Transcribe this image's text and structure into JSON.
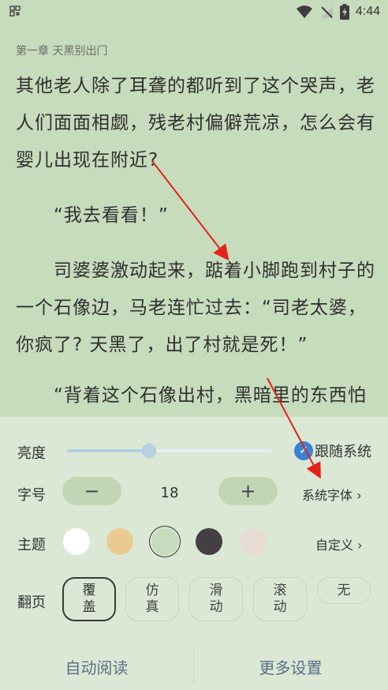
{
  "status_bar": {
    "left_icon": "qr-grid-icon",
    "icons": [
      "wifi-icon",
      "no-signal-icon",
      "battery-charging-icon"
    ],
    "time": "4:44"
  },
  "reader": {
    "chapter_title": "第一章 天黑别出门",
    "paragraphs": [
      "其他老人除了耳聋的都听到了这个哭声，老人们面面相觑，残老村偏僻荒凉，怎么会有婴儿出现在附近?",
      "“我去看看！”",
      "司婆婆激动起来，踮着小脚跑到村子的一个石像边，马老连忙过去：“司老太婆，你疯了? 天黑了，出了村就是死！”",
      "“背着这个石像出村，黑暗里的东西怕"
    ]
  },
  "settings": {
    "brightness": {
      "label": "亮度",
      "level": 0.4,
      "follow_system_label": "跟随系统",
      "follow_system_checked": true
    },
    "font": {
      "label": "字号",
      "decrease_label": "−",
      "value": "18",
      "increase_label": "+",
      "font_link": "系统字体 ›"
    },
    "theme": {
      "label": "主题",
      "colors": [
        "#ffffff",
        "#ebca92",
        "#c7dbbd",
        "#433f42",
        "#e6dcd4"
      ],
      "selected_index": 2,
      "custom_link": "自定义 ›"
    },
    "page_turn": {
      "label": "翻页",
      "options": [
        "覆盖",
        "仿真",
        "滑动",
        "滚动",
        "无"
      ],
      "selected_index": 0
    }
  },
  "bottom_bar": {
    "auto_read": "自动阅读",
    "more_settings": "更多设置"
  }
}
